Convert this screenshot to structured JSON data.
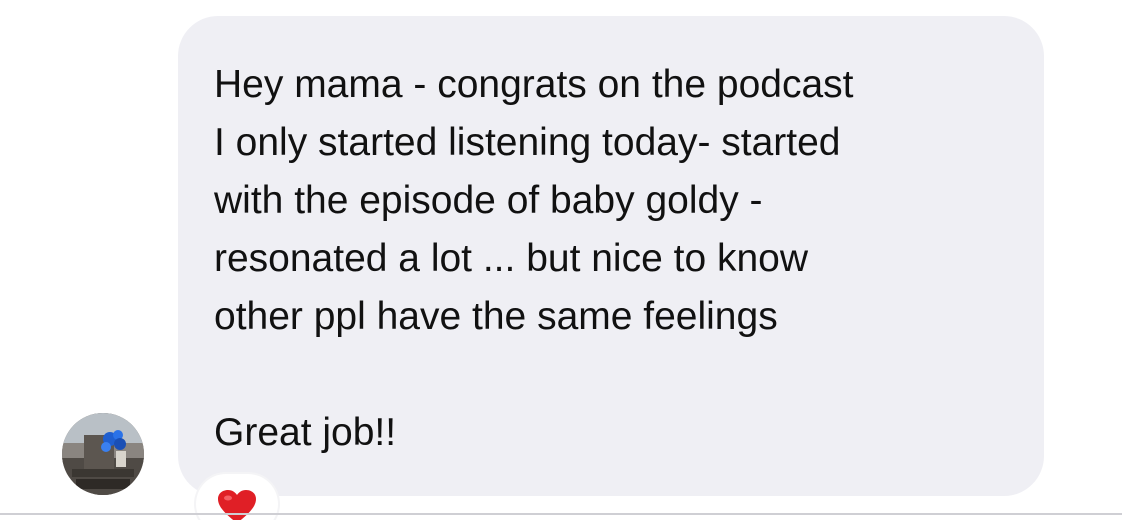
{
  "message": {
    "lines": [
      "Hey mama - congrats on the podcast",
      "I only started listening today- started",
      "with the episode of baby goldy -",
      "resonated a lot ... but nice to know",
      "other ppl have the same feelings",
      "",
      "Great job!!"
    ]
  },
  "reaction": {
    "icon": "red-heart-icon",
    "color": "#e01f26"
  },
  "colors": {
    "bubble": "#efeff4",
    "text": "#111111",
    "divider": "#cfcfd4"
  },
  "avatar": {
    "icon": "profile-photo"
  }
}
